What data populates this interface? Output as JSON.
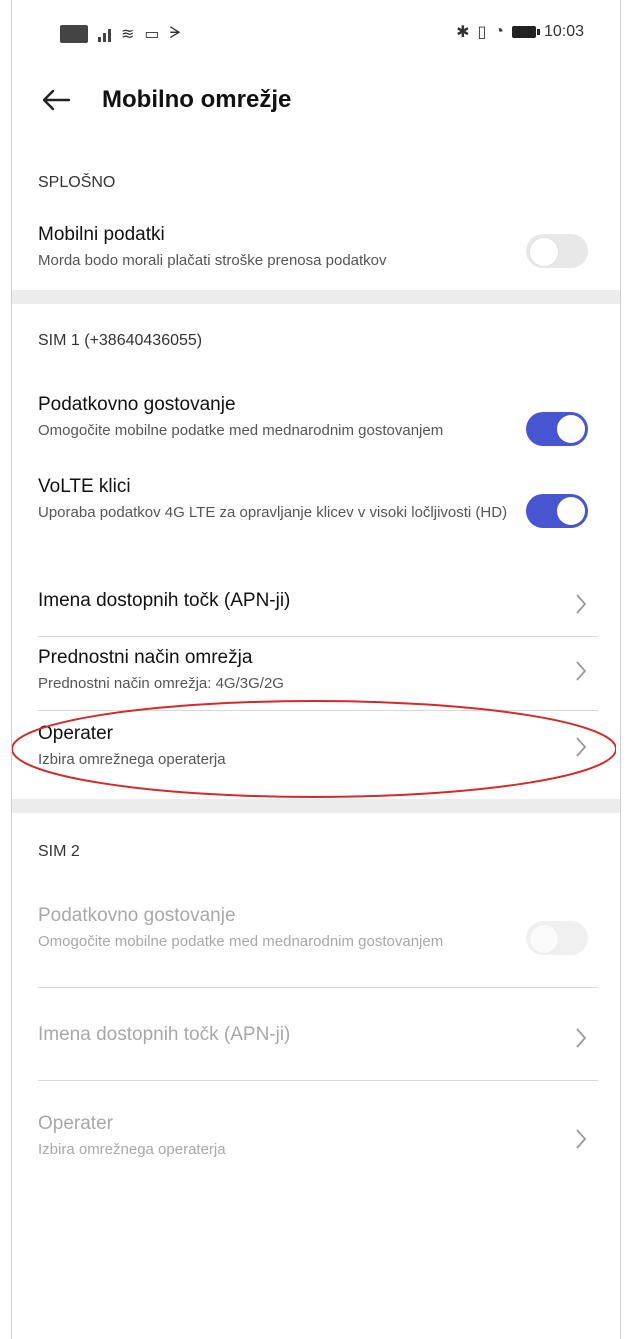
{
  "status_bar": {
    "time": "10:03"
  },
  "header": {
    "title": "Mobilno omrežje"
  },
  "general": {
    "label": "SPLOŠNO",
    "mobile_data": {
      "title": "Mobilni podatki",
      "subtitle": "Morda bodo morali plačati stroške prenosa podatkov",
      "enabled": false
    }
  },
  "sim1": {
    "label": "SIM 1 (+38640436055)",
    "roaming": {
      "title": "Podatkovno gostovanje",
      "subtitle": "Omogočite mobilne podatke med mednarodnim gostovanjem",
      "enabled": true
    },
    "volte": {
      "title": "VoLTE klici",
      "subtitle": "Uporaba podatkov 4G LTE za opravljanje klicev v visoki ločljivosti (HD)",
      "enabled": true
    },
    "apn": {
      "title": "Imena dostopnih točk (APN-ji)"
    },
    "network_mode": {
      "title": "Prednostni način omrežja",
      "subtitle": "Prednostni način omrežja: 4G/3G/2G"
    },
    "operator": {
      "title": "Operater",
      "subtitle": "Izbira omrežnega operaterja"
    }
  },
  "sim2": {
    "label": "SIM 2",
    "roaming": {
      "title": "Podatkovno gostovanje",
      "subtitle": "Omogočite mobilne podatke med mednarodnim gostovanjem",
      "enabled": false
    },
    "apn": {
      "title": "Imena dostopnih točk (APN-ji)"
    },
    "operator": {
      "title": "Operater",
      "subtitle": "Izbira omrežnega operaterja"
    }
  },
  "colors": {
    "accent": "#4756d0",
    "annotation": "#d42a2a"
  }
}
